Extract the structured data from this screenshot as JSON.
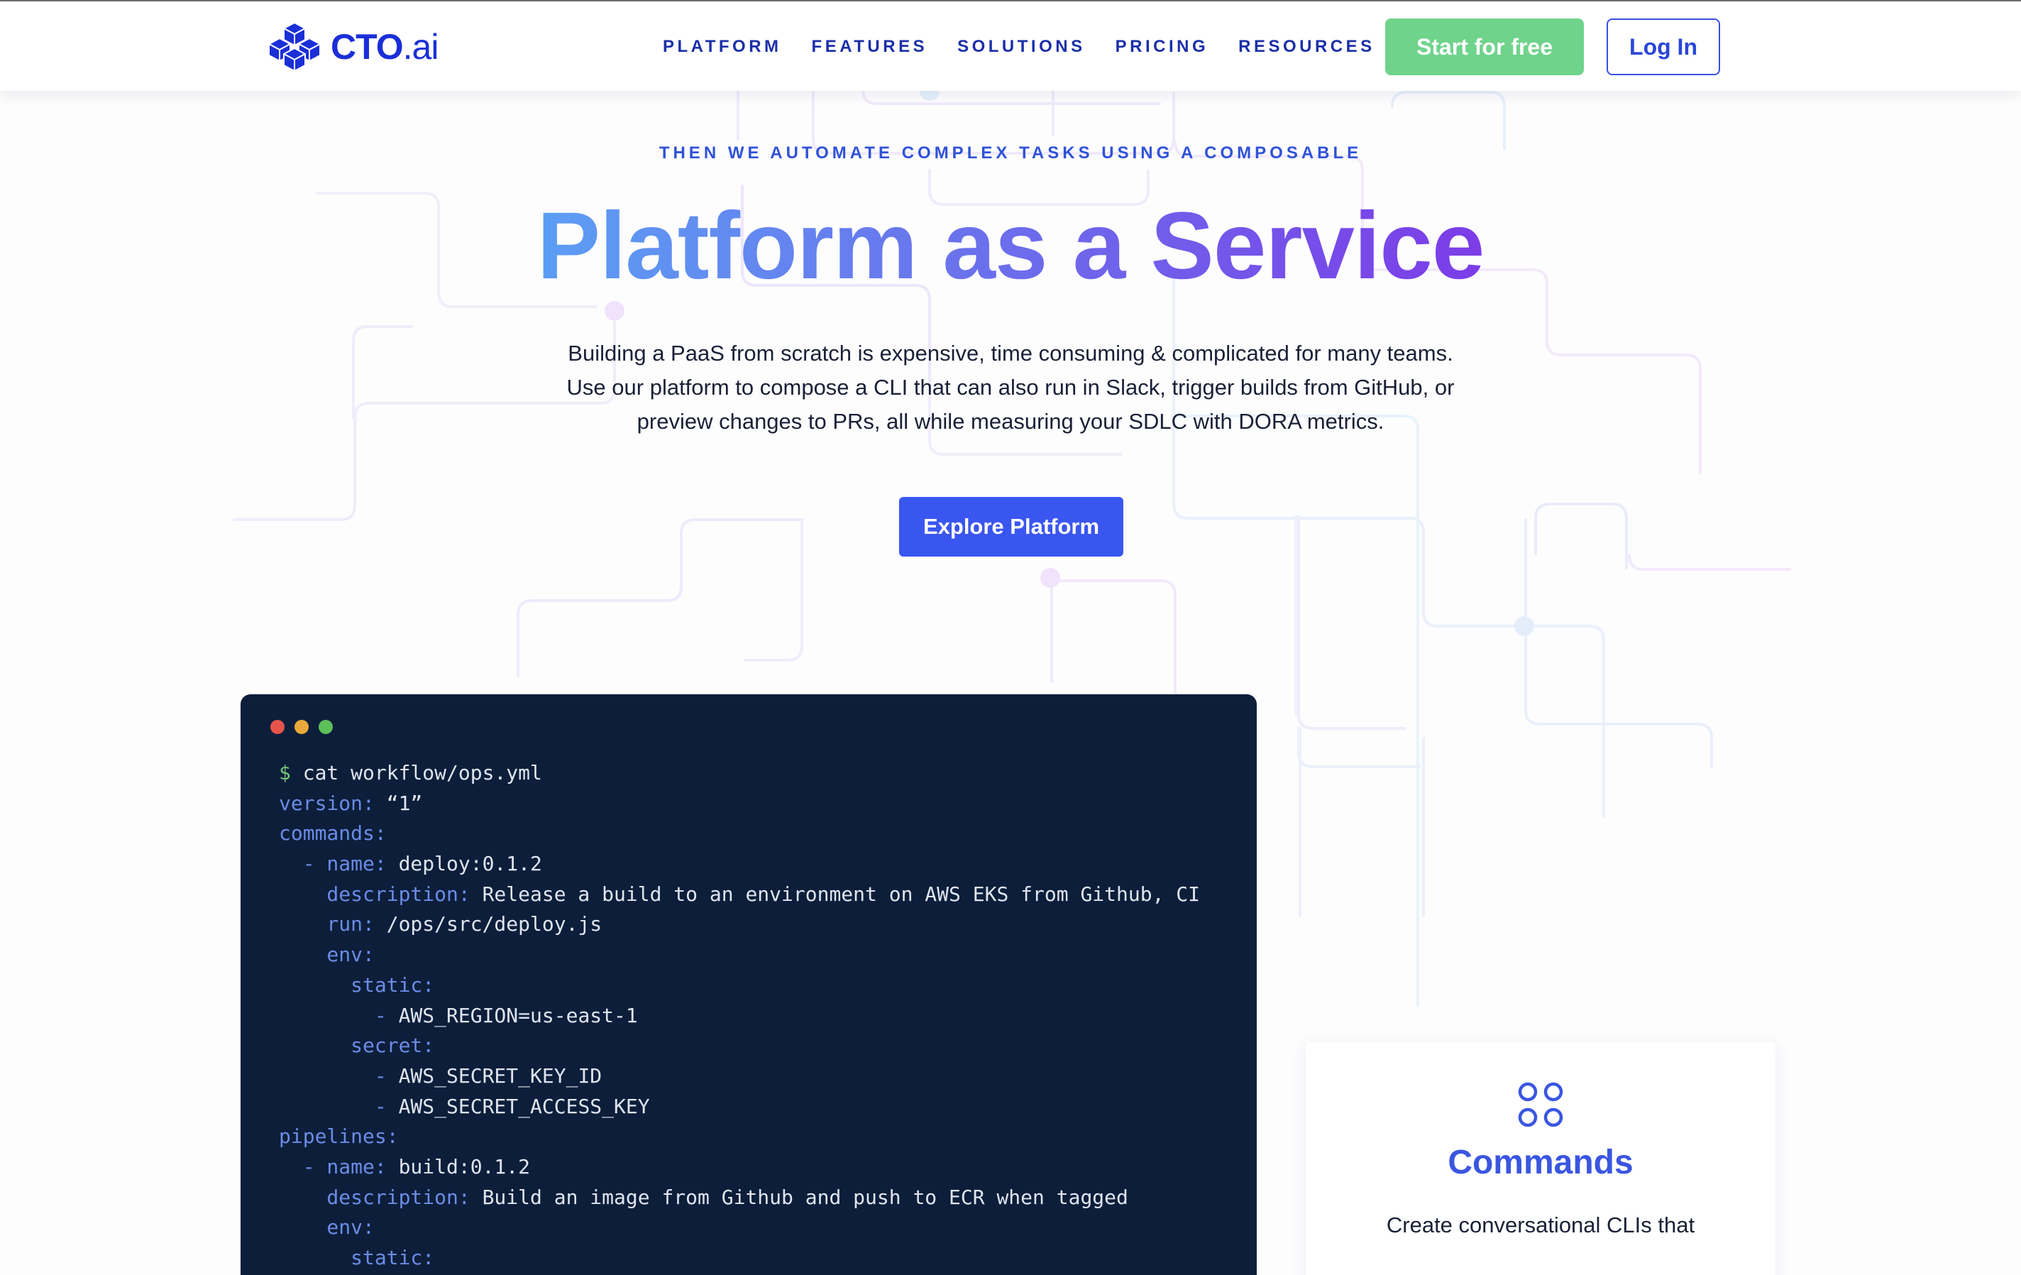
{
  "brand": {
    "name_main": "CTO",
    "name_suffix": ".ai"
  },
  "nav": {
    "items": [
      "PLATFORM",
      "FEATURES",
      "SOLUTIONS",
      "PRICING",
      "RESOURCES"
    ],
    "start_label": "Start for free",
    "login_label": "Log In"
  },
  "hero": {
    "eyebrow": "THEN WE AUTOMATE COMPLEX TASKS USING A COMPOSABLE",
    "headline": "Platform as a Service",
    "lead": [
      "Building a PaaS from scratch is expensive, time consuming & complicated for many teams.",
      "Use our platform to compose a CLI that can also run in Slack, trigger builds from GitHub, or",
      "preview changes to PRs, all while measuring your SDLC with DORA metrics."
    ],
    "cta_label": "Explore Platform"
  },
  "terminal": {
    "lines": [
      {
        "prompt": "$ ",
        "key": "",
        "value": "cat workflow/ops.yml"
      },
      {
        "prompt": "",
        "key": "version:",
        "value": " “1”"
      },
      {
        "prompt": "",
        "key": "commands:",
        "value": ""
      },
      {
        "prompt": "",
        "key": "  - name:",
        "value": " deploy:0.1.2"
      },
      {
        "prompt": "",
        "key": "    description:",
        "value": " Release a build to an environment on AWS EKS from Github, CI"
      },
      {
        "prompt": "",
        "key": "    run:",
        "value": " /ops/src/deploy.js"
      },
      {
        "prompt": "",
        "key": "    env:",
        "value": ""
      },
      {
        "prompt": "",
        "key": "      static:",
        "value": ""
      },
      {
        "prompt": "",
        "key": "        -",
        "value": " AWS_REGION=us-east-1"
      },
      {
        "prompt": "",
        "key": "      secret:",
        "value": ""
      },
      {
        "prompt": "",
        "key": "        -",
        "value": " AWS_SECRET_KEY_ID"
      },
      {
        "prompt": "",
        "key": "        -",
        "value": " AWS_SECRET_ACCESS_KEY"
      },
      {
        "prompt": "",
        "key": "pipelines:",
        "value": ""
      },
      {
        "prompt": "",
        "key": "  - name:",
        "value": " build:0.1.2"
      },
      {
        "prompt": "",
        "key": "    description:",
        "value": " Build an image from Github and push to ECR when tagged"
      },
      {
        "prompt": "",
        "key": "    env:",
        "value": ""
      },
      {
        "prompt": "",
        "key": "      static:",
        "value": ""
      }
    ]
  },
  "feature_card": {
    "icon": "four-circles-icon",
    "title": "Commands",
    "text": "Create conversational CLIs that"
  },
  "colors": {
    "brand_blue": "#1b2fd8",
    "start_green": "#6fd38c",
    "cta_blue": "#3a56f0",
    "terminal_bg": "#0c1e3a",
    "yaml_key": "#6b8ce6"
  }
}
